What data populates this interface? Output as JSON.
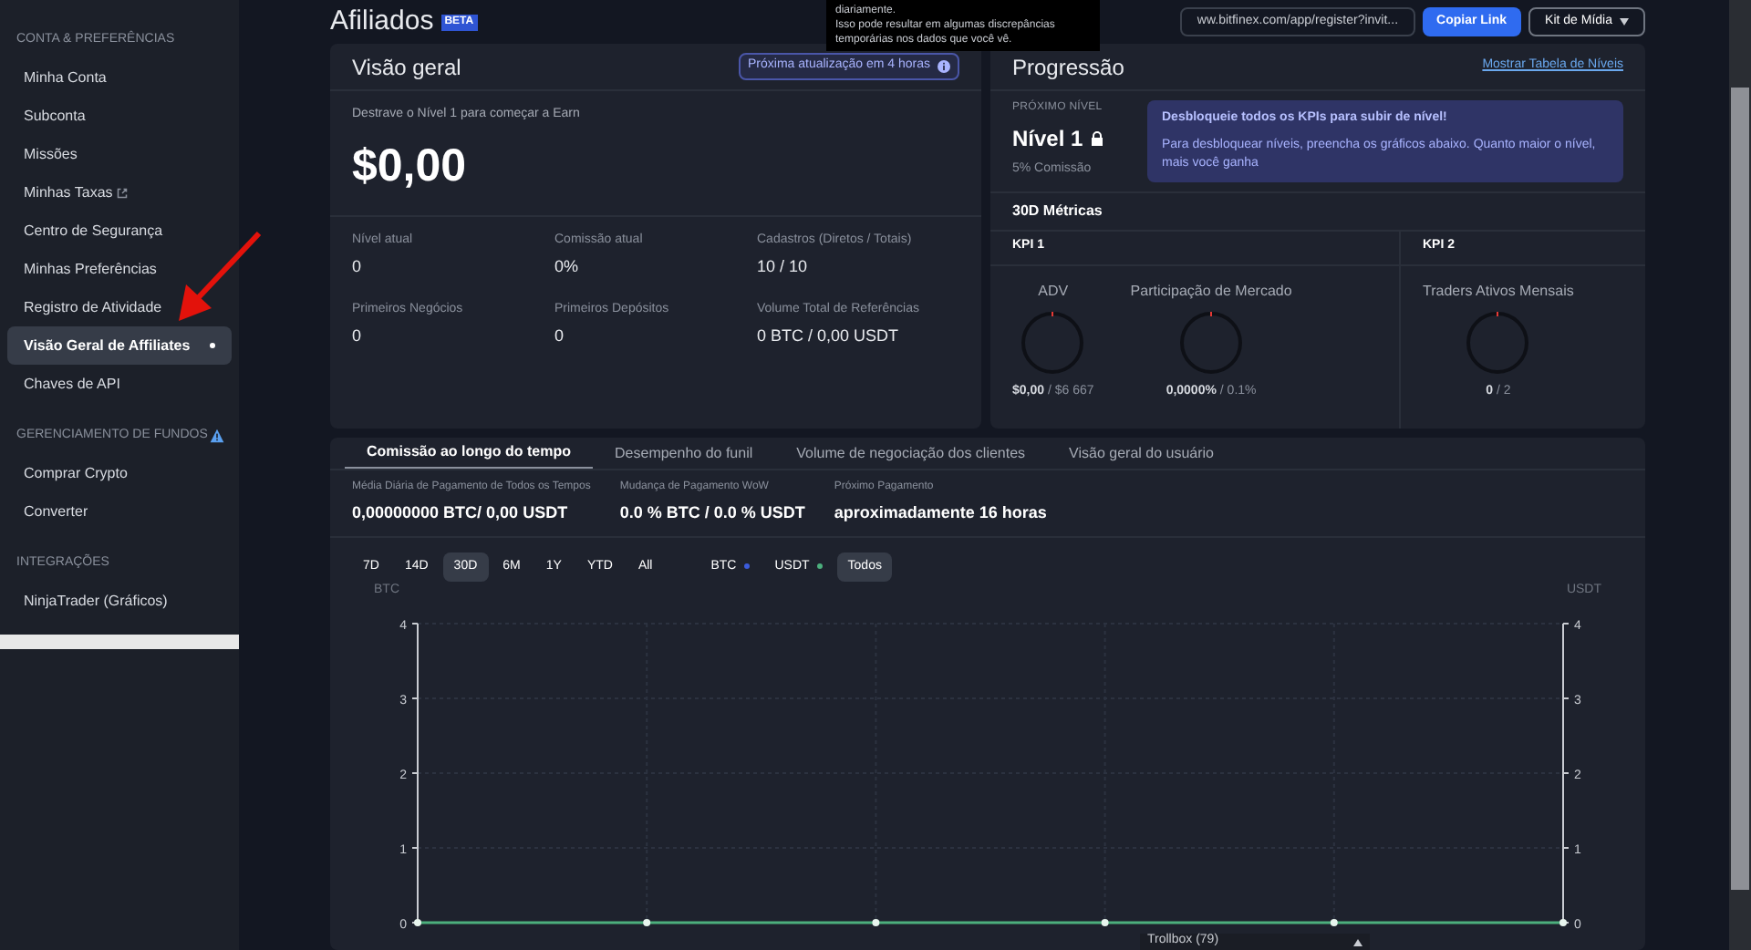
{
  "sidebar": {
    "sections": [
      {
        "title": "CONTA & PREFERÊNCIAS",
        "alert": false,
        "items": [
          {
            "label": "Minha Conta",
            "selected": false,
            "external": false
          },
          {
            "label": "Subconta",
            "selected": false,
            "external": false
          },
          {
            "label": "Missões",
            "selected": false,
            "external": false
          },
          {
            "label": "Minhas Taxas",
            "selected": false,
            "external": true
          },
          {
            "label": "Centro de Segurança",
            "selected": false,
            "external": false
          },
          {
            "label": "Minhas Preferências",
            "selected": false,
            "external": false
          },
          {
            "label": "Registro de Atividade",
            "selected": false,
            "external": false
          },
          {
            "label": "Visão Geral de Affiliates",
            "selected": true,
            "external": false
          },
          {
            "label": "Chaves de API",
            "selected": false,
            "external": false
          }
        ]
      },
      {
        "title": "GERENCIAMENTO DE FUNDOS",
        "alert": true,
        "items": [
          {
            "label": "Comprar Crypto",
            "selected": false,
            "external": false
          },
          {
            "label": "Converter",
            "selected": false,
            "external": false
          }
        ]
      },
      {
        "title": "INTEGRAÇÕES",
        "alert": false,
        "items": [
          {
            "label": "NinjaTrader (Gráficos)",
            "selected": false,
            "external": false
          }
        ]
      }
    ]
  },
  "header": {
    "title": "Afiliados",
    "badge": "BETA",
    "link": "ww.bitfinex.com/app/register?invit...",
    "copy_button": "Copiar Link",
    "media_button": "Kit de Mídia"
  },
  "tooltip": {
    "lines": [
      "diariamente.",
      "Isso pode resultar em algumas discrepâncias",
      "temporárias nos dados que você vê."
    ]
  },
  "overview": {
    "title": "Visão geral",
    "update_badge": "Próxima atualização em 4 horas",
    "unlock_text": "Destrave o Nível 1 para começar a Earn",
    "amount": "$0,00",
    "stats": [
      {
        "label": "Nível atual",
        "value": "0"
      },
      {
        "label": "Comissão atual",
        "value": "0%"
      },
      {
        "label": "Cadastros (Diretos / Totais)",
        "value": "10 / 10"
      },
      {
        "label": "Primeiros Negócios",
        "value": "0"
      },
      {
        "label": "Primeiros Depósitos",
        "value": "0"
      },
      {
        "label": "Volume Total de Referências",
        "value": "0 BTC / 0,00 USDT"
      }
    ]
  },
  "progression": {
    "title": "Progressão",
    "table_link": "Mostrar Tabela de Níveis",
    "next_level_label": "PRÓXIMO NÍVEL",
    "level": "Nível 1",
    "locked": true,
    "commission": "5% Comissão",
    "notice": {
      "title": "Desbloqueie todos os KPIs para subir de nível!",
      "text": "Para desbloquear níveis, preencha os gráficos abaixo. Quanto maior o nível, mais você ganha"
    },
    "metrics_title": "30D Métricas",
    "kpis": [
      {
        "title": "KPI 1",
        "gauges": [
          {
            "label": "ADV",
            "current": "$0,00",
            "target": "/ $6 667"
          },
          {
            "label": "Participação de Mercado",
            "current": "0,0000%",
            "target": "/ 0.1%"
          }
        ]
      },
      {
        "title": "KPI 2",
        "gauges": [
          {
            "label": "Traders Ativos Mensais",
            "current": "0",
            "target": "/ 2"
          }
        ]
      }
    ]
  },
  "commission": {
    "tabs": [
      {
        "label": "Comissão ao longo do tempo",
        "selected": true
      },
      {
        "label": "Desempenho do funil",
        "selected": false
      },
      {
        "label": "Volume de negociação dos clientes",
        "selected": false
      },
      {
        "label": "Visão geral do usuário",
        "selected": false
      }
    ],
    "stats": [
      {
        "label": "Média Diária de Pagamento de Todos os Tempos",
        "value": "0,00000000 BTC/ 0,00 USDT"
      },
      {
        "label": "Mudança de Pagamento WoW",
        "value": "0.0 % BTC / 0.0 % USDT"
      },
      {
        "label": "Próximo Pagamento",
        "value": "aproximadamente 16 horas"
      }
    ],
    "ranges": [
      {
        "label": "7D",
        "selected": false
      },
      {
        "label": "14D",
        "selected": false
      },
      {
        "label": "30D",
        "selected": true
      },
      {
        "label": "6M",
        "selected": false
      },
      {
        "label": "1Y",
        "selected": false
      },
      {
        "label": "YTD",
        "selected": false
      },
      {
        "label": "All",
        "selected": false
      }
    ],
    "legend": [
      {
        "label": "BTC",
        "color": "#3b5bdb",
        "selected": false
      },
      {
        "label": "USDT",
        "color": "#4caf7d",
        "selected": false
      },
      {
        "label": "Todos",
        "selected": true
      }
    ],
    "right_axis": {
      "ticks": [
        "4",
        "3",
        "2",
        "1",
        "0"
      ]
    },
    "chart_data": {
      "type": "line",
      "ylabel": "BTC",
      "ylim": [
        0,
        4
      ],
      "yticks": [
        0,
        1,
        2,
        3,
        4
      ],
      "grid": true,
      "series": [
        {
          "name": "USDT",
          "color": "#4caf7d",
          "marker": true,
          "values": [
            0,
            0,
            0,
            0,
            0,
            0
          ]
        }
      ]
    }
  },
  "trollbox": {
    "label": "Trollbox (79)"
  }
}
